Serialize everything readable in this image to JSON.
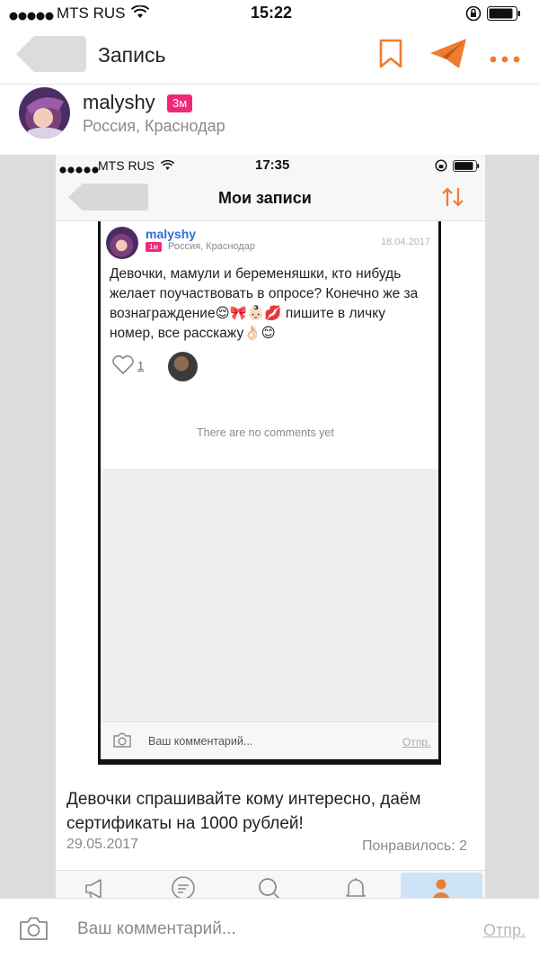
{
  "status_bar": {
    "carrier": "MTS RUS",
    "time": "15:22"
  },
  "nav": {
    "title": "Запись"
  },
  "author": {
    "name": "malyshy",
    "badge": "3м",
    "location": "Россия, Краснодар"
  },
  "inner": {
    "status_bar": {
      "carrier": "MTS RUS",
      "time": "17:35"
    },
    "title": "Мои записи",
    "post": {
      "author": "malyshy",
      "badge": "1м",
      "location": "Россия, Краснодар",
      "date": "18.04.2017",
      "text": "Девочки, мамули и беременяшки, кто нибудь желает поучаствовать в опросе? Конечно же за вознаграждение😌🎀👶🏻💋 пишите в личку номер, все расскажу👌🏻😊",
      "likes": "1"
    },
    "no_comments": "There are no comments yet",
    "comment_placeholder": "Ваш комментарий...",
    "send_label": "Отпр."
  },
  "post": {
    "text": "Девочки спрашивайте кому интересно, даём сертификаты на 1000 рублей!",
    "date": "29.05.2017",
    "likes_label": "Понравилось: 2"
  },
  "comment": {
    "placeholder": "Ваш комментарий...",
    "send_label": "Отпр."
  },
  "colors": {
    "accent": "#f07c2f",
    "badge": "#f0287a",
    "link": "#2f6fd6"
  }
}
